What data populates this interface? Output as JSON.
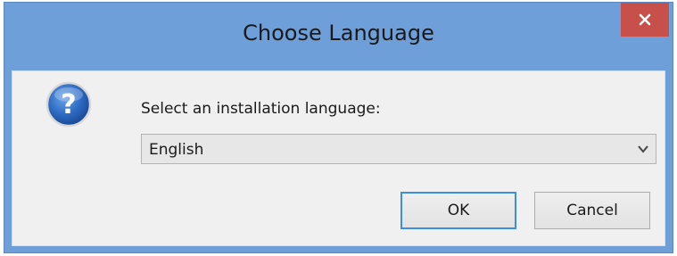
{
  "window": {
    "title": "Choose Language",
    "close_icon": "close-icon"
  },
  "dialog": {
    "icon": "question-icon",
    "prompt": "Select an installation language:",
    "language_select": {
      "selected": "English"
    },
    "buttons": {
      "ok": "OK",
      "cancel": "Cancel"
    }
  },
  "colors": {
    "titlebar": "#6f9fd9",
    "close_button": "#c7504a",
    "client_bg": "#f0f0f0",
    "ok_focus_border": "#3c8ee0"
  }
}
